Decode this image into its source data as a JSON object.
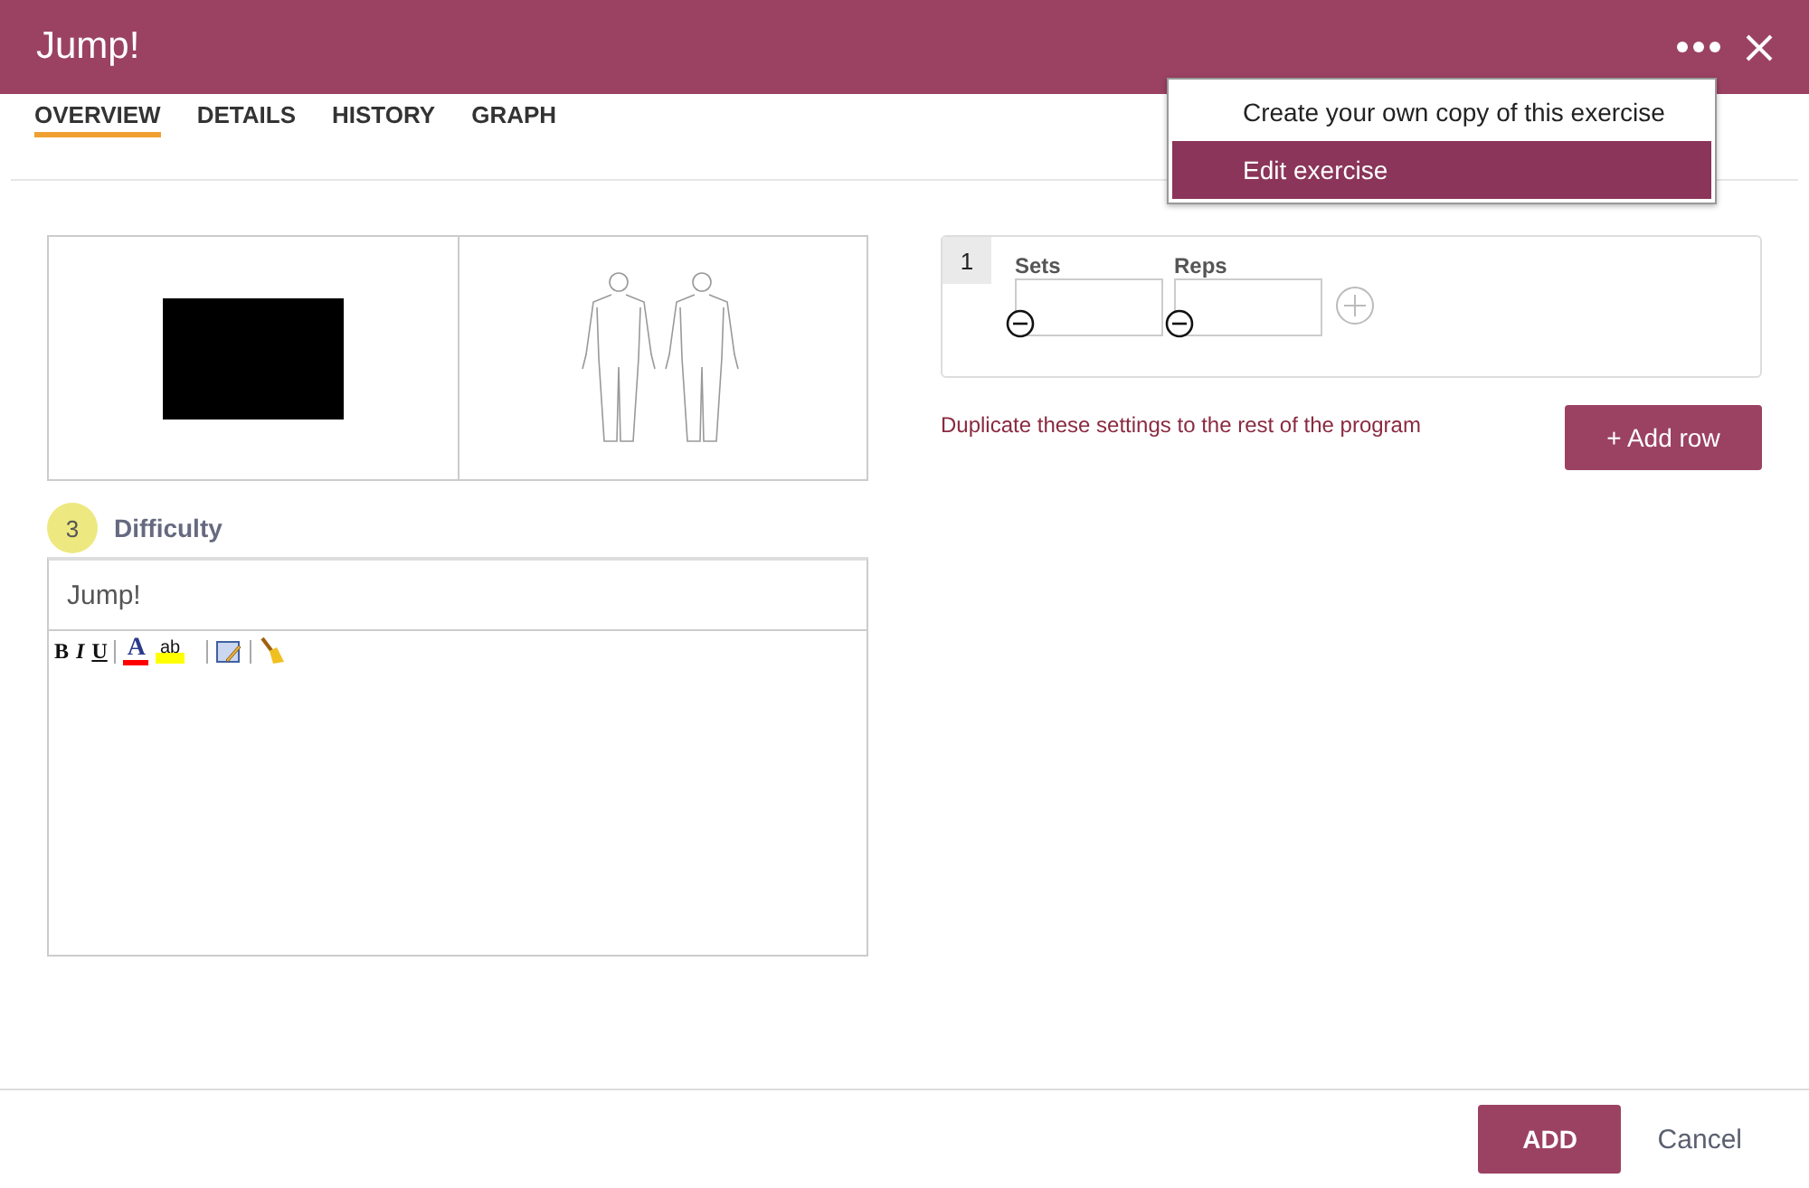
{
  "window": {
    "title": "Jump!"
  },
  "tabs": [
    {
      "label": "OVERVIEW",
      "selected": true
    },
    {
      "label": "DETAILS",
      "selected": false
    },
    {
      "label": "HISTORY",
      "selected": false
    },
    {
      "label": "GRAPH",
      "selected": false
    }
  ],
  "menu": {
    "items": [
      {
        "label": "Create your own copy of this exercise",
        "selected": false
      },
      {
        "label": "Edit exercise",
        "selected": true
      }
    ]
  },
  "difficulty": {
    "value": "3",
    "label": "Difficulty"
  },
  "exercise_name": {
    "value": "Jump!"
  },
  "editor_toolbar": [
    {
      "kind": "bold",
      "label": "B"
    },
    {
      "kind": "italic",
      "label": "I"
    },
    {
      "kind": "underline",
      "label": "U"
    },
    {
      "kind": "separator"
    },
    {
      "kind": "font-color",
      "label": "A"
    },
    {
      "kind": "highlight",
      "label": "ab"
    },
    {
      "kind": "separator"
    },
    {
      "kind": "insert"
    },
    {
      "kind": "separator"
    },
    {
      "kind": "clear"
    }
  ],
  "set_rows": [
    {
      "number": "1",
      "fields": [
        {
          "label": "Sets"
        },
        {
          "label": "Reps"
        }
      ]
    }
  ],
  "duplicate_link": "Duplicate these settings to the rest of the program",
  "add_row_button": "+ Add row",
  "footer": {
    "primary": "ADD",
    "secondary": "Cancel"
  }
}
